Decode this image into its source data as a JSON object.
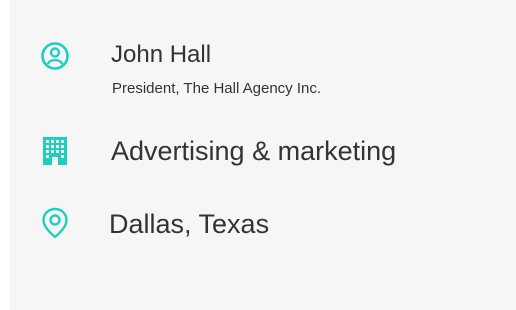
{
  "colors": {
    "accent": "#1ecfc0",
    "text": "#333333",
    "card_background": "#f6f6f6",
    "page_background": "#ffffff"
  },
  "contact": {
    "name": "John Hall",
    "title": "President, The Hall Agency Inc.",
    "icon": "user-circle-icon"
  },
  "industry": {
    "label": "Advertising & marketing",
    "icon": "building-icon"
  },
  "location": {
    "label": "Dallas, Texas",
    "icon": "location-pin-icon"
  }
}
